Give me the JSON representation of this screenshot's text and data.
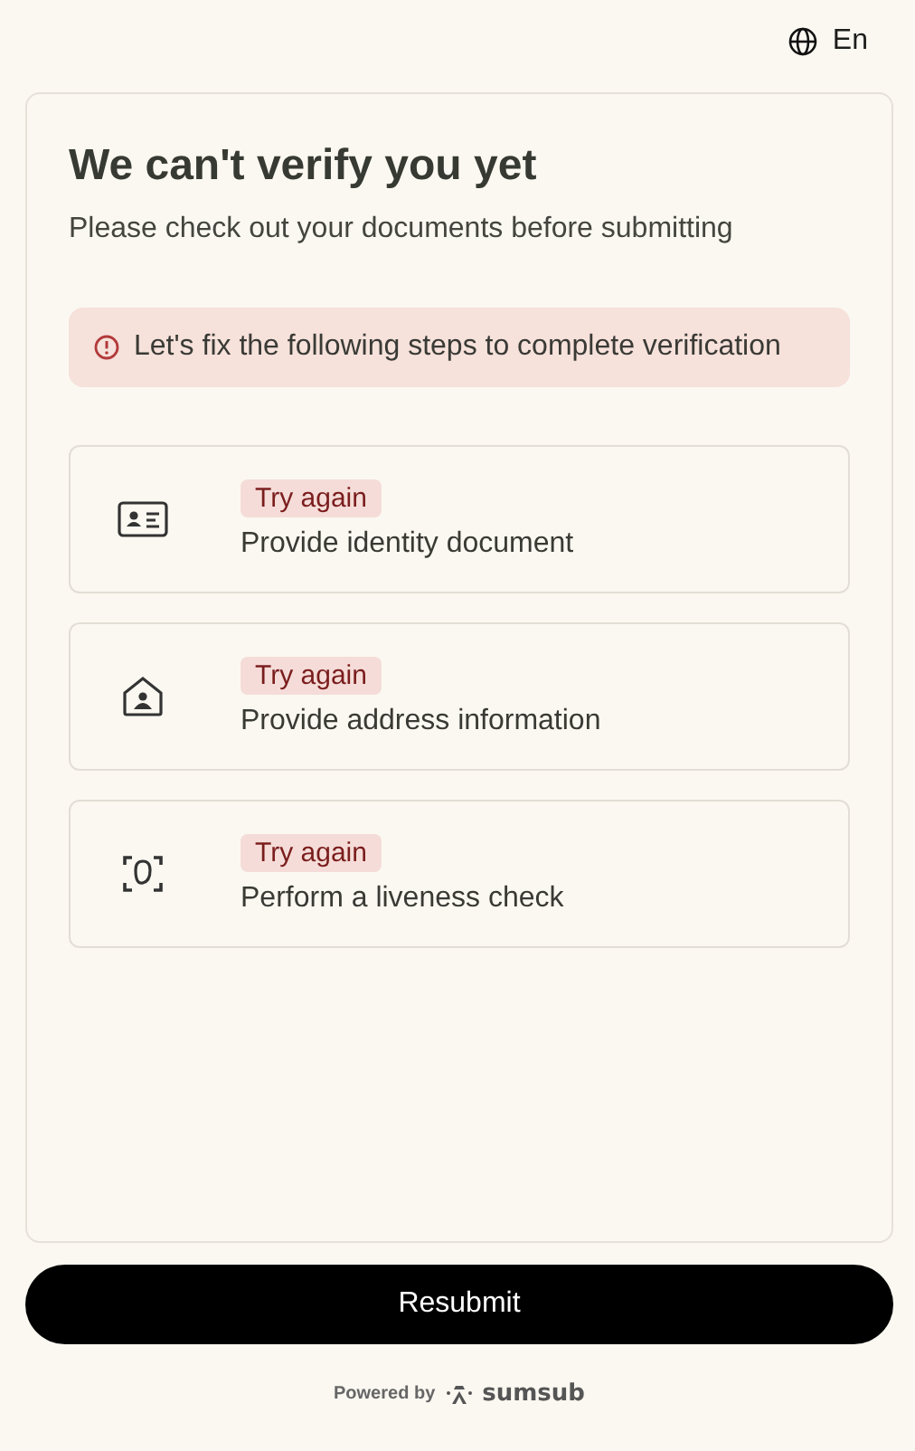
{
  "language": {
    "label": "En"
  },
  "title": "We can't verify you yet",
  "subtitle": "Please check out your documents before submitting",
  "alert": {
    "text": "Let's fix the following steps to complete verification"
  },
  "steps": [
    {
      "kind": "id",
      "status": "Try again",
      "label": "Provide identity document"
    },
    {
      "kind": "address",
      "status": "Try again",
      "label": "Provide address information"
    },
    {
      "kind": "liveness",
      "status": "Try again",
      "label": "Perform a liveness check"
    }
  ],
  "button": "Resubmit",
  "footer": {
    "prefix": "Powered by",
    "brand": "sumsub"
  }
}
